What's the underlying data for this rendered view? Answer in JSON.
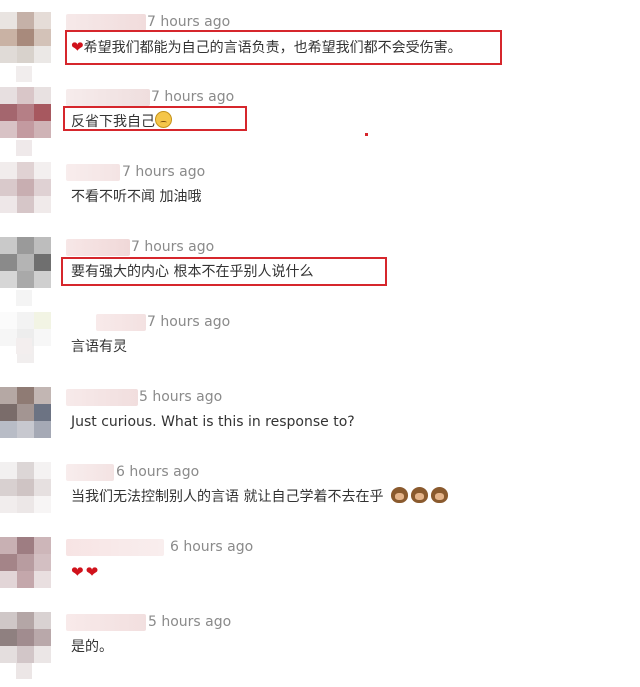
{
  "comments": [
    {
      "time": "7 hours ago",
      "text": "希望我们都能为自己的言语负责，也希望我们都不会受伤害。",
      "emoji_before": "heart"
    },
    {
      "time": "7 hours ago",
      "text": "反省下我自己",
      "emoji_after": "pensive-face"
    },
    {
      "time": "7 hours ago",
      "text": "不看不听不闻 加油哦"
    },
    {
      "time": "7 hours ago",
      "text": "要有强大的内心 根本不在乎别人说什么"
    },
    {
      "time": "7 hours ago",
      "text": "言语有灵"
    },
    {
      "time": "5 hours ago",
      "text": "Just curious. What is this in response to?"
    },
    {
      "time": "6 hours ago",
      "text": "当我们无法控制别人的言语 就让自己学着不去在乎",
      "emoji_after": "three-wise-monkeys"
    },
    {
      "time": "6 hours ago",
      "text": "",
      "emoji_only": "two-hearts"
    },
    {
      "time": "5 hours ago",
      "text": "是的。"
    }
  ],
  "colors": {
    "highlight_box": "#d6262c",
    "time_text": "#8a8a8a",
    "body_text": "#333333"
  }
}
